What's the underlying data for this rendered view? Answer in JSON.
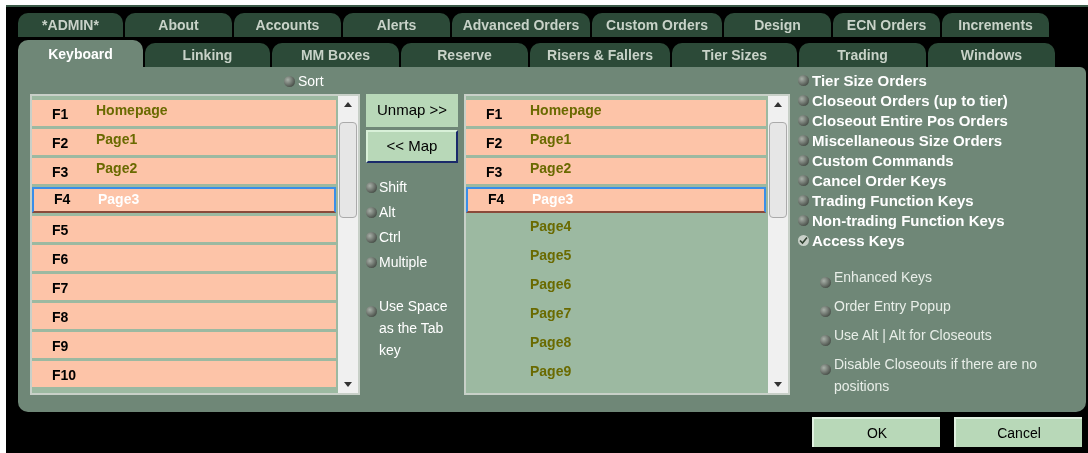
{
  "tabs_row_1": [
    {
      "label": "*ADMIN*",
      "selected": false
    },
    {
      "label": "About",
      "selected": false
    },
    {
      "label": "Accounts",
      "selected": false
    },
    {
      "label": "Alerts",
      "selected": false
    },
    {
      "label": "Advanced Orders",
      "selected": false
    },
    {
      "label": "Custom Orders",
      "selected": false
    },
    {
      "label": "Design",
      "selected": false
    },
    {
      "label": "ECN Orders",
      "selected": false
    },
    {
      "label": "Increments",
      "selected": false
    }
  ],
  "tabs_row_2": [
    {
      "label": "Keyboard",
      "selected": true
    },
    {
      "label": "Linking",
      "selected": false
    },
    {
      "label": "MM Boxes",
      "selected": false
    },
    {
      "label": "Reserve",
      "selected": false
    },
    {
      "label": "Risers & Fallers",
      "selected": false
    },
    {
      "label": "Tier Sizes",
      "selected": false
    },
    {
      "label": "Trading",
      "selected": false
    },
    {
      "label": "Windows",
      "selected": false
    }
  ],
  "sort": {
    "label": "Sort",
    "checked": false
  },
  "left_list": [
    {
      "key": "F1",
      "name": "Homepage",
      "mapped": true,
      "selected": false
    },
    {
      "key": "F2",
      "name": "Page1",
      "mapped": true,
      "selected": false
    },
    {
      "key": "F3",
      "name": "Page2",
      "mapped": true,
      "selected": false
    },
    {
      "key": "F4",
      "name": "Page3",
      "mapped": true,
      "selected": true
    },
    {
      "key": "F5",
      "mapped": true,
      "selected": false
    },
    {
      "key": "F6",
      "mapped": true,
      "selected": false
    },
    {
      "key": "F7",
      "mapped": true,
      "selected": false
    },
    {
      "key": "F8",
      "mapped": true,
      "selected": false
    },
    {
      "key": "F9",
      "mapped": true,
      "selected": false
    },
    {
      "key": "F10",
      "mapped": true,
      "selected": false
    }
  ],
  "buttons_middle": [
    "Unmap >>",
    "<< Map"
  ],
  "modifiers": [
    {
      "label": "Shift",
      "checked": false
    },
    {
      "label": "Alt",
      "checked": false
    },
    {
      "label": "Ctrl",
      "checked": false
    },
    {
      "label": "Multiple",
      "checked": false
    }
  ],
  "space_option": {
    "label": "Use Space as the Tab key",
    "checked": false
  },
  "right_list": [
    {
      "key": "F1",
      "name": "Homepage",
      "mapped": true,
      "selected": false
    },
    {
      "key": "F2",
      "name": "Page1",
      "mapped": true,
      "selected": false
    },
    {
      "key": "F3",
      "name": "Page2",
      "mapped": true,
      "selected": false
    },
    {
      "key": "F4",
      "name": "Page3",
      "mapped": true,
      "selected": true
    },
    {
      "name": "Page4",
      "mapped": false,
      "selected": false
    },
    {
      "name": "Page5",
      "mapped": false,
      "selected": false
    },
    {
      "name": "Page6",
      "mapped": false,
      "selected": false
    },
    {
      "name": "Page7",
      "mapped": false,
      "selected": false
    },
    {
      "name": "Page8",
      "mapped": false,
      "selected": false
    },
    {
      "name": "Page9",
      "mapped": false,
      "selected": false
    }
  ],
  "categories": [
    {
      "label": "Tier Size Orders",
      "selected": false
    },
    {
      "label": "Closeout Orders (up to tier)",
      "selected": false
    },
    {
      "label": "Closeout Entire Pos Orders",
      "selected": false
    },
    {
      "label": "Miscellaneous Size Orders",
      "selected": false
    },
    {
      "label": "Custom Commands",
      "selected": false
    },
    {
      "label": "Cancel Order Keys",
      "selected": false
    },
    {
      "label": "Trading Function Keys",
      "selected": false
    },
    {
      "label": "Non-trading Function Keys",
      "selected": false
    },
    {
      "label": "Access Keys",
      "selected": true
    }
  ],
  "options": [
    {
      "label": "Enhanced Keys",
      "checked": false
    },
    {
      "label": "Order Entry Popup",
      "checked": false
    },
    {
      "label": "Use Alt | Alt for Closeouts",
      "checked": false
    },
    {
      "label": "Disable Closeouts if there are no positions",
      "checked": false
    }
  ],
  "buttons_bottom": [
    "OK",
    "Cancel"
  ]
}
